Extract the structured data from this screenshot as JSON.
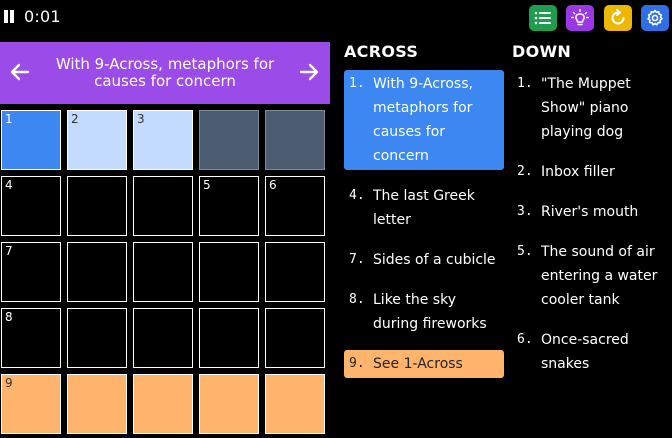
{
  "header": {
    "timer": "0:01",
    "icons": [
      "pause-icon",
      "list-icon",
      "lightbulb-icon",
      "reset-icon",
      "gear-icon"
    ],
    "button_colors": {
      "list": "#1e9d4d",
      "hint": "#9b38e6",
      "reset": "#efb800",
      "settings": "#2f6fe3"
    }
  },
  "current_clue": {
    "text": "With 9-Across, metaphors for causes for concern",
    "color": "#9b4ce8"
  },
  "grid": {
    "rows": [
      [
        {
          "num": "1",
          "state": "active"
        },
        {
          "num": "2",
          "state": "word"
        },
        {
          "num": "3",
          "state": "word"
        },
        {
          "num": "",
          "state": "block"
        },
        {
          "num": "",
          "state": "block"
        }
      ],
      [
        {
          "num": "4",
          "state": "empty"
        },
        {
          "num": "",
          "state": "empty"
        },
        {
          "num": "",
          "state": "empty"
        },
        {
          "num": "5",
          "state": "empty"
        },
        {
          "num": "6",
          "state": "empty"
        }
      ],
      [
        {
          "num": "7",
          "state": "empty"
        },
        {
          "num": "",
          "state": "empty"
        },
        {
          "num": "",
          "state": "empty"
        },
        {
          "num": "",
          "state": "empty"
        },
        {
          "num": "",
          "state": "empty"
        }
      ],
      [
        {
          "num": "8",
          "state": "empty"
        },
        {
          "num": "",
          "state": "empty"
        },
        {
          "num": "",
          "state": "empty"
        },
        {
          "num": "",
          "state": "empty"
        },
        {
          "num": "",
          "state": "empty"
        }
      ],
      [
        {
          "num": "9",
          "state": "alt"
        },
        {
          "num": "",
          "state": "alt"
        },
        {
          "num": "",
          "state": "alt"
        },
        {
          "num": "",
          "state": "alt"
        },
        {
          "num": "",
          "state": "alt"
        }
      ]
    ]
  },
  "across": {
    "heading": "ACROSS",
    "clues": [
      {
        "num": "1.",
        "lines": [
          "With 9-Across,",
          "metaphors for",
          "causes for",
          "concern"
        ],
        "state": "selected"
      },
      {
        "num": "4.",
        "lines": [
          "The last Greek",
          "letter"
        ],
        "state": ""
      },
      {
        "num": "7.",
        "lines": [
          "Sides of a cubicle"
        ],
        "state": ""
      },
      {
        "num": "8.",
        "lines": [
          "Like the sky",
          "during fireworks"
        ],
        "state": ""
      },
      {
        "num": "9.",
        "lines": [
          "See 1-Across"
        ],
        "state": "related"
      }
    ]
  },
  "down": {
    "heading": "DOWN",
    "clues": [
      {
        "num": "1.",
        "lines": [
          "\"The Muppet",
          "Show\" piano",
          "playing dog"
        ],
        "state": ""
      },
      {
        "num": "2.",
        "lines": [
          "Inbox filler"
        ],
        "state": ""
      },
      {
        "num": "3.",
        "lines": [
          "River's mouth"
        ],
        "state": ""
      },
      {
        "num": "5.",
        "lines": [
          "The sound of air",
          "entering a water",
          "cooler tank"
        ],
        "state": ""
      },
      {
        "num": "6.",
        "lines": [
          "Once-sacred",
          "snakes"
        ],
        "state": ""
      }
    ]
  }
}
